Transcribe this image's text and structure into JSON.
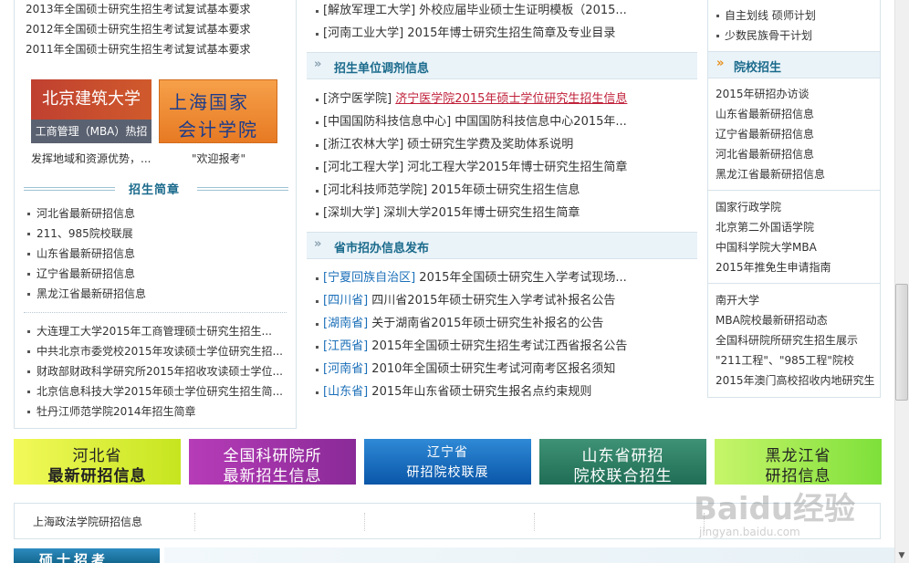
{
  "left": {
    "top_links": [
      "2013年全国硕士研究生招生考试复试基本要求",
      "2012年全国硕士研究生招生考试复试基本要求",
      "2011年全国硕士研究生招生考试复试基本要求"
    ],
    "banner1": {
      "title": "北京建筑大学",
      "subtitle": "工商管理（MBA）热招"
    },
    "banner2": {
      "line1": "上海国家",
      "line2": "会计学院"
    },
    "captions": [
      "发挥地域和资源优势，...",
      "\"欢迎报考\""
    ],
    "section_title": "招生简章",
    "list1": [
      "河北省最新研招信息",
      "211、985院校联展",
      "山东省最新研招信息",
      "辽宁省最新研招信息",
      "黑龙江省最新研招信息"
    ],
    "list2": [
      "大连理工大学2015年工商管理硕士研究生招生...",
      "中共北京市委党校2015年攻读硕士学位研究生招...",
      "财政部财政科学研究所2015年招收攻读硕士学位...",
      "北京信息科技大学2015年硕士学位研究生招生简...",
      "牡丹江师范学院2014年招生简章"
    ]
  },
  "middle": {
    "top_list": [
      {
        "tag": "[解放军理工大学]",
        "text": "外校应届毕业硕士生证明模板（2015..."
      },
      {
        "tag": "[河南工业大学]",
        "text": "2015年博士研究生招生简章及专业目录"
      }
    ],
    "section1_title": "招生单位调剂信息",
    "section1_list": [
      {
        "tag": "[济宁医学院]",
        "text": "济宁医学院2015年硕士学位研究生招生信息"
      },
      {
        "tag": "[中国国防科技信息中心]",
        "text": "中国国防科技信息中心2015年..."
      },
      {
        "tag": "[浙江农林大学]",
        "text": "硕士研究生学费及奖助体系说明"
      },
      {
        "tag": "[河北工程大学]",
        "text": "河北工程大学2015年博士研究生招生简章"
      },
      {
        "tag": "[河北科技师范学院]",
        "text": "2015年硕士研究生招生信息"
      },
      {
        "tag": "[深圳大学]",
        "text": "深圳大学2015年博士研究生招生简章"
      }
    ],
    "section2_title": "省市招办信息发布",
    "section2_list": [
      {
        "tag": "[宁夏回族自治区]",
        "text": "2015年全国硕士研究生入学考试现场..."
      },
      {
        "tag": "[四川省]",
        "text": "四川省2015年硕士研究生入学考试补报名公告"
      },
      {
        "tag": "[湖南省]",
        "text": "关于湖南省2015年硕士研究生补报名的公告"
      },
      {
        "tag": "[江西省]",
        "text": "2015年全国硕士研究生招生考试江西省报名公告"
      },
      {
        "tag": "[河南省]",
        "text": "2010年全国硕士研究生考试河南考区报名须知"
      },
      {
        "tag": "[山东省]",
        "text": "2015年山东省硕士研究生报名点约束规则"
      }
    ]
  },
  "right": {
    "top_list": [
      "自主划线   硕师计划",
      "少数民族骨干计划"
    ],
    "section_title": "院校招生",
    "group1": [
      "2015年研招办访谈",
      "山东省最新研招信息",
      "辽宁省最新研招信息",
      "河北省最新研招信息",
      "黑龙江省最新研招信息"
    ],
    "group2": [
      "国家行政学院",
      "北京第二外国语学院",
      "中国科学院大学MBA",
      "2015年推免生申请指南"
    ],
    "group3": [
      "南开大学",
      "MBA院校最新研招动态",
      "全国科研院所研究生招生展示",
      "\"211工程\"、\"985工程\"院校",
      "2015年澳门高校招收内地研究生"
    ]
  },
  "bottom_banners": [
    {
      "line1": "河北省",
      "line2": "最新研招信息"
    },
    {
      "line1": "全国科研院所",
      "line2": "最新招生信息"
    },
    {
      "line1": "辽宁省",
      "line2": "研招院校联展"
    },
    {
      "line1": "山东省研招",
      "line2": "院校联合招生"
    },
    {
      "line1": "黑龙江省",
      "line2": "研招信息"
    }
  ],
  "link_bar": [
    "上海政法学院研招信息"
  ],
  "bottom_tab": "硕士招考",
  "watermark": {
    "logo": "Baidu经验",
    "url": "jingyan.baidu.com"
  },
  "colors": {
    "accent": "#1a6a8c",
    "highlight": "#c0213a",
    "tag_blue": "#1b6fb8",
    "border": "#d7e3ea"
  }
}
